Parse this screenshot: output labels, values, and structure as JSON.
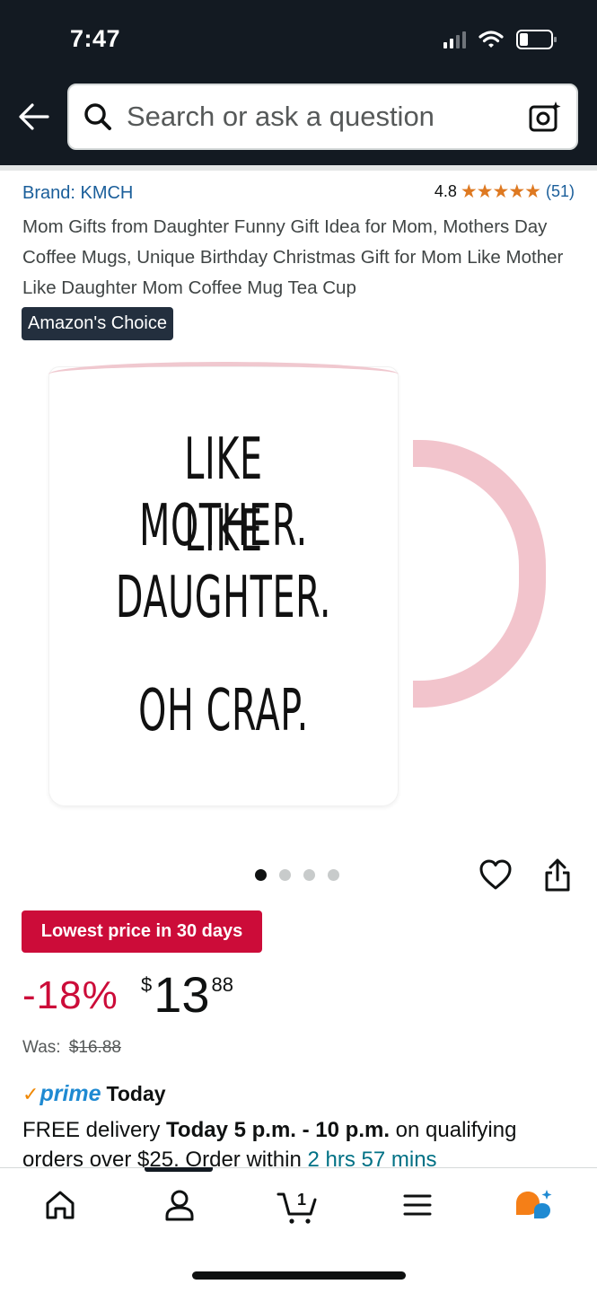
{
  "status_bar": {
    "time": "7:47"
  },
  "search": {
    "placeholder": "Search or ask a question"
  },
  "product": {
    "brand": "Brand: KMCH",
    "rating": "4.8",
    "stars": "★★★★★",
    "review_count": "(51)",
    "title": "Mom Gifts from Daughter Funny Gift Idea for Mom, Mothers Day Coffee Mugs, Unique Birthday Christmas Gift for Mom Like Mother Like Daughter Mom Coffee Mug Tea Cup",
    "badge": "Amazon's Choice",
    "image_text": {
      "line1": "LIKE MOTHER.",
      "line2": "LIKE DAUGHTER.",
      "line3": "OH CRAP."
    },
    "image_count": 4,
    "active_image": 1
  },
  "pricing": {
    "deal_badge": "Lowest price in 30 days",
    "discount": "-18%",
    "currency": "$",
    "price_whole": "13",
    "price_fraction": "88",
    "was_label": "Was:",
    "was_price": "$16.88"
  },
  "delivery": {
    "prime_check": "✓",
    "prime_word": "prime",
    "prime_day": "Today",
    "line_prefix": "FREE delivery ",
    "window": "Today 5 p.m. - 10 p.m.",
    "line_mid": " on qualifying orders over $25. Order within ",
    "countdown": "2 hrs 57 mins"
  },
  "bottom_nav": {
    "items": [
      "home-icon",
      "account-icon",
      "cart-icon",
      "menu-icon",
      "rufus-icon"
    ],
    "cart_count": "1"
  },
  "colors": {
    "header_bg": "#131a22",
    "deal_red": "#cc0c39",
    "link_blue": "#1a5e9a",
    "star_orange": "#de7921",
    "prime_blue": "#1f8ad2",
    "mug_pink": "#f2c4cc"
  }
}
